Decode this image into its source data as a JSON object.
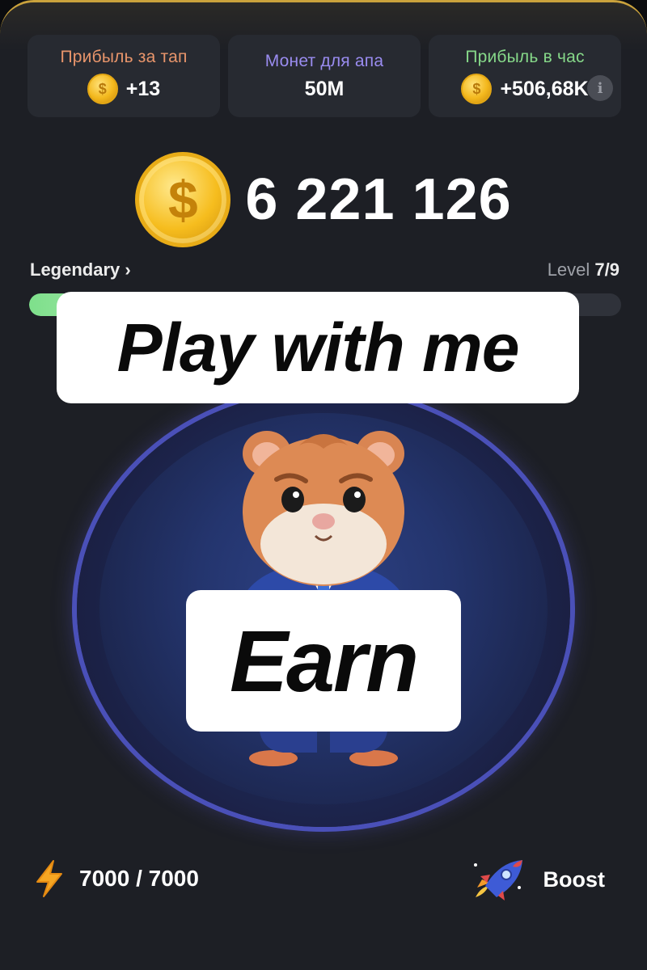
{
  "stats": [
    {
      "label": "Прибыль за тап",
      "value": "+13",
      "label_color": "#e8956b"
    },
    {
      "label": "Монет для апа",
      "value": "50M",
      "label_color": "#9a8cf0"
    },
    {
      "label": "Прибыль в час",
      "value": "+506,68K",
      "label_color": "#86d889"
    }
  ],
  "info_glyph": "i",
  "coin_glyph": "$",
  "balance": "6 221 126",
  "rank": "Legendary",
  "rank_chevron": "›",
  "level_prefix": "Level ",
  "level_value": "7/9",
  "progress_fraction": 0.78,
  "captions": {
    "top": "Play with me",
    "bottom": "Earn"
  },
  "energy": {
    "value": "7000 / 7000",
    "icon": "lightning-icon"
  },
  "boost": {
    "label": "Boost",
    "icon": "rocket-icon"
  },
  "colors": {
    "accent_gold": "#caa23c",
    "coin": "#f3b81d",
    "energy": "#f5a623"
  }
}
